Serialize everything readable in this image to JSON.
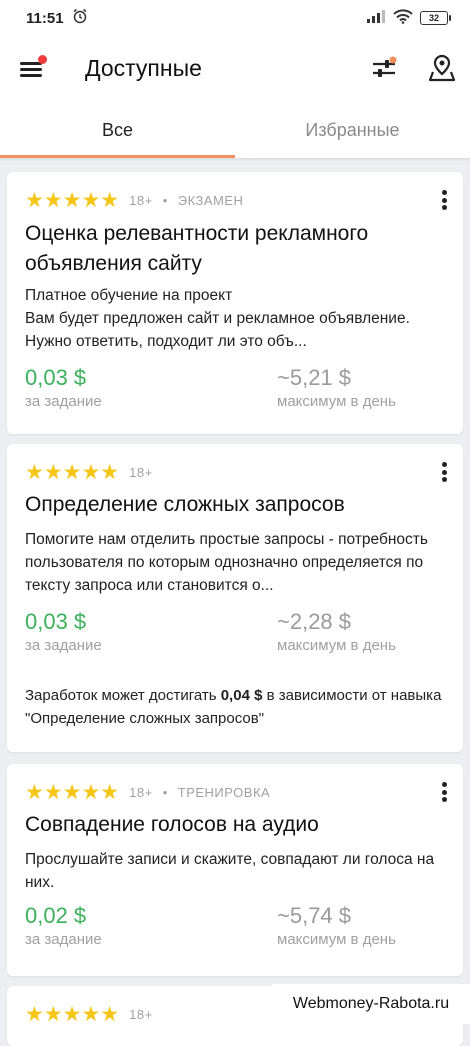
{
  "status_bar": {
    "time": "11:51",
    "battery": "32",
    "icons": [
      "alarm-icon",
      "signal-icon",
      "wifi-icon",
      "battery-icon"
    ]
  },
  "app_bar": {
    "title": "Доступные",
    "notification_dot_color": "#f03c3c"
  },
  "tabs": [
    {
      "label": "Все",
      "active": true
    },
    {
      "label": "Избранные",
      "active": false
    }
  ],
  "accent_color": "#f0905a",
  "cards": [
    {
      "stars": "★★★★★",
      "age": "18+",
      "separator": "•",
      "tag": "ЭКЗАМЕН",
      "title": "Оценка релевантности рекламного объявления сайту",
      "desc_line1": "Платное обучение на проект",
      "desc_line2": "Вам будет предложен сайт и рекламное объявление. Нужно ответить, подходит ли это объ...",
      "price": "0,03 $",
      "price_label": "за задание",
      "max": "~5,21 $",
      "max_label": "максимум в день"
    },
    {
      "stars": "★★★★★",
      "age": "18+",
      "title": "Определение сложных запросов",
      "desc": "Помогите нам отделить простые запросы - потребность пользователя по которым однозначно определяется по тексту запроса или становится о...",
      "price": "0,03 $",
      "price_label": "за задание",
      "max": "~2,28 $",
      "max_label": "максимум в день",
      "earn_prefix": "Заработок может достигать ",
      "earn_amount": "0,04 $",
      "earn_suffix": " в зависимости от навыка \"Определение сложных запросов\""
    },
    {
      "stars": "★★★★★",
      "age": "18+",
      "separator": "•",
      "tag": "ТРЕНИРОВКА",
      "title": "Совпадение голосов на аудио",
      "desc": "Прослушайте записи и скажите, совпадают ли голоса на них.",
      "price": "0,02 $",
      "price_label": "за задание",
      "max": "~5,74 $",
      "max_label": "максимум в день"
    },
    {
      "stars": "★★★★★",
      "age": "18+"
    }
  ],
  "watermark": "Webmoney-Rabota.ru"
}
